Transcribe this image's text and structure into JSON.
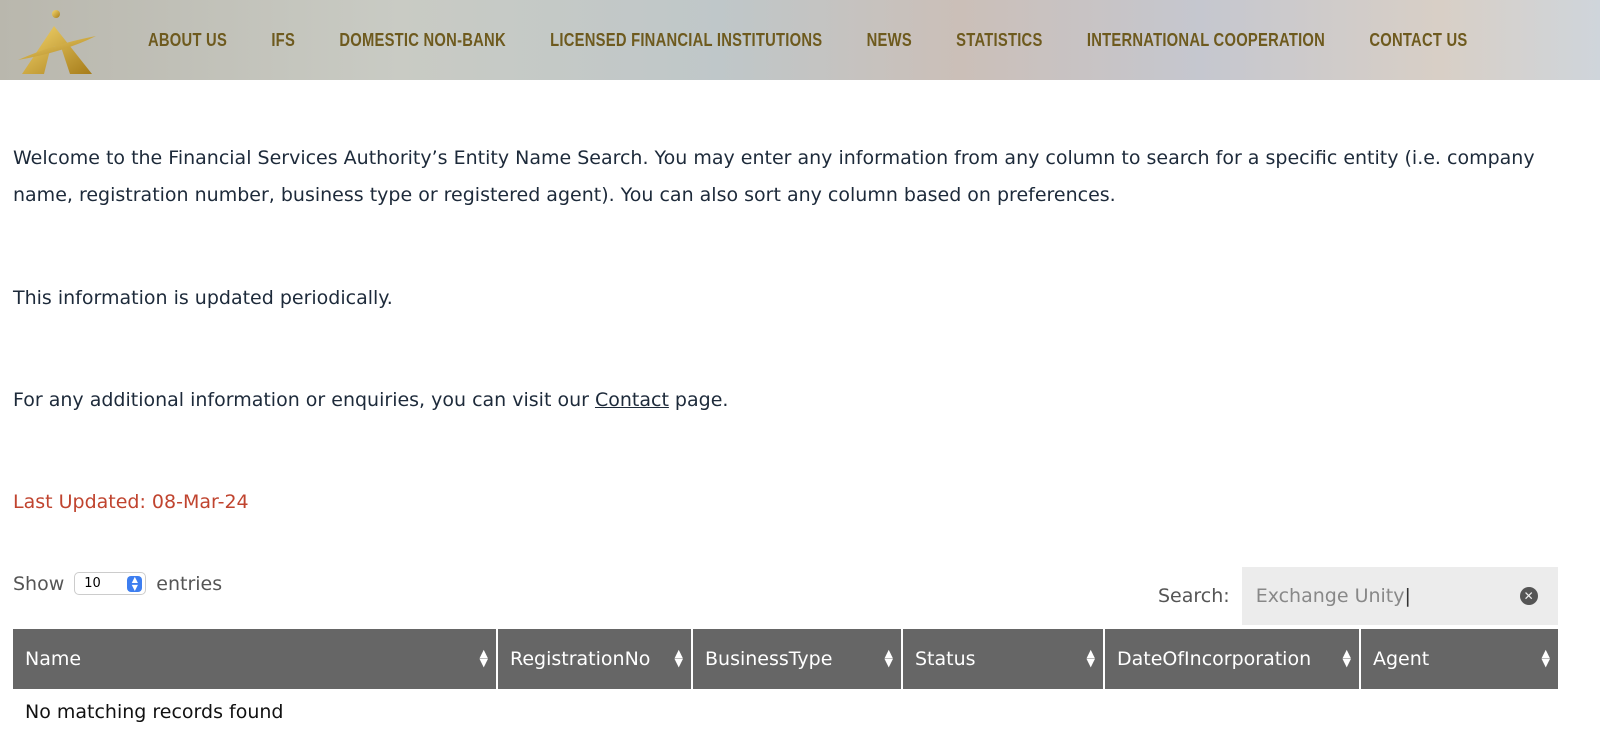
{
  "nav": [
    "ABOUT US",
    "IFS",
    "DOMESTIC NON-BANK",
    "LICENSED FINANCIAL INSTITUTIONS",
    "NEWS",
    "STATISTICS",
    "INTERNATIONAL COOPERATION",
    "CONTACT US"
  ],
  "intro": "Welcome to the Financial Services Authority’s Entity Name Search. You may enter any information from any column to search for a specific entity (i.e. company name, registration number, business type or registered agent). You can also sort any column based on preferences.",
  "updated_note": "This information is updated periodically.",
  "contact_pre": "For any additional information or enquiries, you can visit our ",
  "contact_link": "Contact",
  "contact_post": " page.",
  "last_updated": "Last Updated:  08-Mar-24",
  "show_label": "Show",
  "entries_value": "10",
  "entries_label": "entries",
  "search_label": "Search:",
  "search_value": "Exchange Unity",
  "columns": [
    "Name",
    "RegistrationNo",
    "BusinessType",
    "Status",
    "DateOfIncorporation",
    "Agent"
  ],
  "empty_message": "No matching records found",
  "colors": {
    "nav_text": "#6e5a1e",
    "header_bg": "#666666",
    "last_updated": "#c0442f",
    "logo": "#d4a72c"
  }
}
